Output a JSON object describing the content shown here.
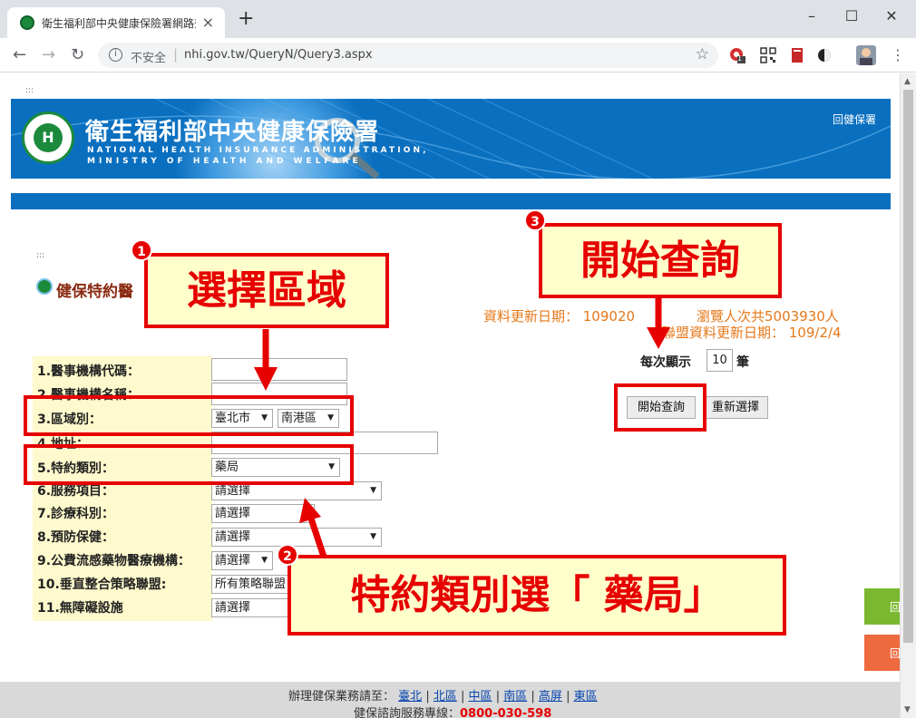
{
  "browser": {
    "tab_title": "衛生福利部中央健康保險署網路查詢",
    "tab_close": "×",
    "new_tab": "+",
    "window": {
      "minimize": "–",
      "maximize": "☐",
      "close": "✕"
    },
    "nav": {
      "back": "←",
      "forward": "→",
      "reload": "↻"
    },
    "security_label": "不安全",
    "url": "nhi.gov.tw/QueryN/Query3.aspx",
    "bookmark_star": "☆",
    "extensions": [
      "extension-red-badge",
      "extension-qr",
      "extension-book",
      "extension-dark"
    ],
    "ext_badge": "1",
    "menu": "⋮"
  },
  "page": {
    "dots_top": ":::",
    "dots_left": ":::",
    "banner": {
      "logo_text": "H",
      "title": "衛生福利部中央健康保險署",
      "subtitle_en_1": "NATIONAL HEALTH INSURANCE ADMINISTRATION,",
      "subtitle_en_2": "MINISTRY OF HEALTH AND WELFARE",
      "back_link": "回健保署"
    },
    "heading": "健保特約醫",
    "update_date": "資料更新日期： 109020",
    "view_count": "瀏覽人次共5003930人",
    "alliance_update": "聯盟資料更新日期： 109/2/4",
    "per_page_label": "每次顯示",
    "per_page_value": "10",
    "per_page_unit": "筆",
    "form": {
      "fields": [
        {
          "label": "1.醫事機構代碼："
        },
        {
          "label": "2.醫事機構名稱："
        },
        {
          "label": "3.區域別："
        },
        {
          "label": "4.地址："
        },
        {
          "label": "5.特約類別："
        },
        {
          "label": "6.服務項目："
        },
        {
          "label": "7.診療科別："
        },
        {
          "label": "8.預防保健："
        },
        {
          "label": "9.公費流感藥物醫療機構："
        },
        {
          "label": "10.垂直整合策略聯盟:"
        },
        {
          "label": "11.無障礙設施"
        }
      ],
      "city_select": "臺北市",
      "district_select": "南港區",
      "category_select": "藥局",
      "service_select": "請選擇",
      "dept_select": "請選擇",
      "prevent_select": "請選擇",
      "flu_select": "請選擇",
      "alliance_select": "所有策略聯盟",
      "access_select": "請選擇"
    },
    "buttons": {
      "search": "開始查詢",
      "reset": "重新選擇"
    },
    "side_tabs": [
      "回",
      "回"
    ],
    "footer": {
      "prefix": "辦理健保業務請至：",
      "links": [
        "臺北",
        "北區",
        "中區",
        "南區",
        "高屏",
        "東區"
      ],
      "separator": "|",
      "hotline_label": "健保諮詢服務專線：",
      "hotline": "0800-030-598"
    }
  },
  "annotations": {
    "step1": {
      "num": "1",
      "text": "選擇區域"
    },
    "step2": {
      "num": "2",
      "text": "特約類別選「 藥局」"
    },
    "step3": {
      "num": "3",
      "text": "開始查詢"
    }
  },
  "colors": {
    "annotation_red": "#e60000",
    "callout_bg": "#ffffcc",
    "banner_blue": "#0a6fbf",
    "update_orange": "#e5781a",
    "form_bg": "#fffacd"
  }
}
